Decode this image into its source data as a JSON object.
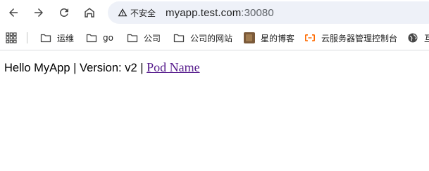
{
  "toolbar": {
    "back_icon": "arrow-left-icon",
    "forward_icon": "arrow-right-icon",
    "reload_icon": "reload-icon",
    "home_icon": "home-icon",
    "security_label": "不安全",
    "url_host": "myapp.test.com",
    "url_port": ":30080"
  },
  "bookmarks": {
    "items": [
      {
        "label": "运维",
        "icon": "folder-icon"
      },
      {
        "label": "go",
        "icon": "folder-icon"
      },
      {
        "label": "公司",
        "icon": "folder-icon"
      },
      {
        "label": "公司的网站",
        "icon": "folder-icon"
      },
      {
        "label": "星的博客",
        "icon": "site-favicon"
      },
      {
        "label": "云服务器管理控制台",
        "icon": "aliyun-icon"
      },
      {
        "label": "互",
        "icon": "globe-icon"
      }
    ]
  },
  "page": {
    "prefix_text": "Hello MyApp | Version: v2 | ",
    "link_text": "Pod Name"
  },
  "colors": {
    "omnibox_bg": "#eef1f8",
    "link_visited": "#551a8b",
    "aliyun_orange": "#ff6a00"
  }
}
